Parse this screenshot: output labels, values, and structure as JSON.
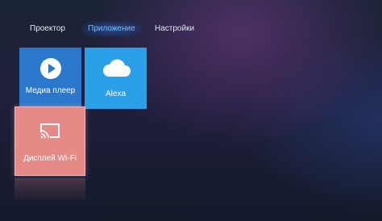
{
  "nav": {
    "tabs": [
      {
        "label": "Проектор",
        "active": false
      },
      {
        "label": "Приложение",
        "active": true
      },
      {
        "label": "Настройки",
        "active": false
      }
    ]
  },
  "tiles": [
    {
      "label": "Медиа плеер",
      "icon": "play-icon",
      "color": "#2a78cc"
    },
    {
      "label": "Alexa",
      "icon": "cloud-icon",
      "color": "#2aa0ea"
    },
    {
      "label": "Дисплей Wi-Fi",
      "icon": "screen-cast-icon",
      "color": "#e68a88",
      "focused": true
    }
  ]
}
